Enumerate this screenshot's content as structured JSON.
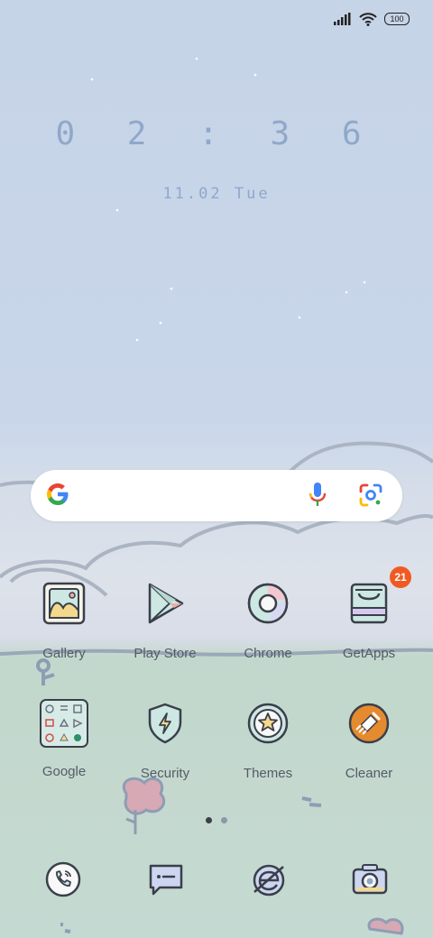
{
  "status_bar": {
    "battery": "100",
    "signal_icon": "signal-bars-icon",
    "wifi_icon": "wifi-icon"
  },
  "lock_clock": {
    "time": "0 2 : 3 6",
    "date": "11.02 Tue"
  },
  "search_bar": {
    "logo": "google-g-icon",
    "mic": "microphone-icon",
    "lens": "google-lens-icon"
  },
  "apps_row1": [
    {
      "label": "Gallery",
      "icon": "gallery-icon"
    },
    {
      "label": "Play Store",
      "icon": "play-store-icon"
    },
    {
      "label": "Chrome",
      "icon": "chrome-icon"
    },
    {
      "label": "GetApps",
      "icon": "getapps-icon",
      "badge": "21"
    }
  ],
  "apps_row2": [
    {
      "label": "Google",
      "icon": "google-folder-icon"
    },
    {
      "label": "Security",
      "icon": "security-shield-icon"
    },
    {
      "label": "Themes",
      "icon": "themes-star-icon"
    },
    {
      "label": "Cleaner",
      "icon": "cleaner-brush-icon"
    }
  ],
  "page_indicator": {
    "pages": 2,
    "current": 1
  },
  "dock": [
    {
      "icon": "phone-icon"
    },
    {
      "icon": "messages-icon"
    },
    {
      "icon": "browser-icon"
    },
    {
      "icon": "camera-icon"
    }
  ],
  "colors": {
    "accent_blue": "#8fa8c9",
    "badge": "#f05a22",
    "label": "#555b66"
  }
}
